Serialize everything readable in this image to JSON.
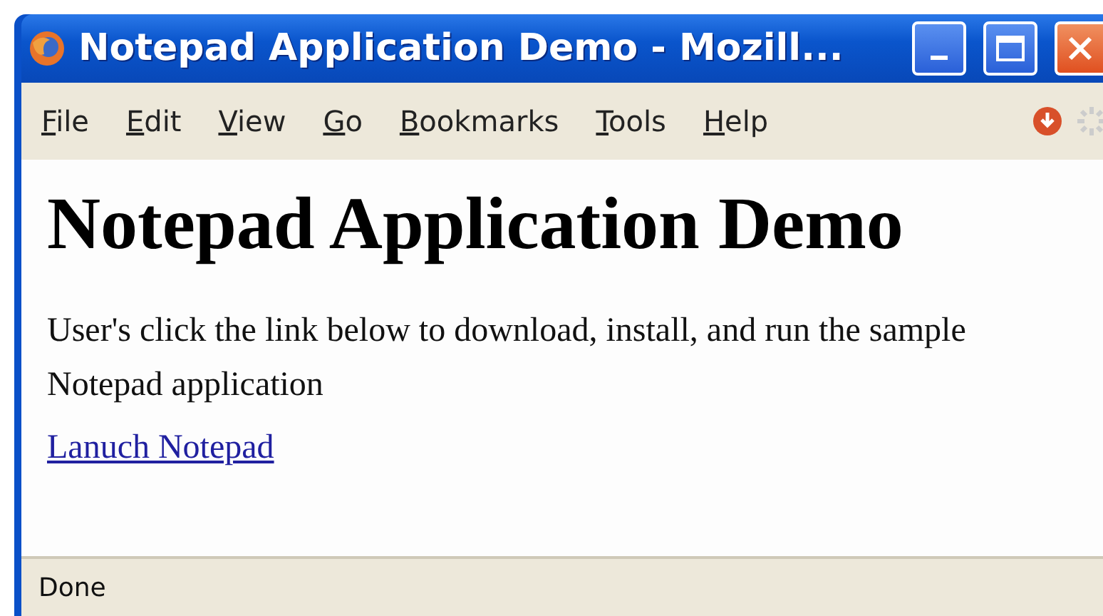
{
  "window": {
    "title": "Notepad Application Demo - Mozill..."
  },
  "menu": [
    "File",
    "Edit",
    "View",
    "Go",
    "Bookmarks",
    "Tools",
    "Help"
  ],
  "page": {
    "heading": "Notepad Application Demo",
    "paragraph": "User's click the link below to download, install, and run the sample Notepad application",
    "link": "Lanuch Notepad"
  },
  "status_bar": {
    "text": "Done"
  }
}
